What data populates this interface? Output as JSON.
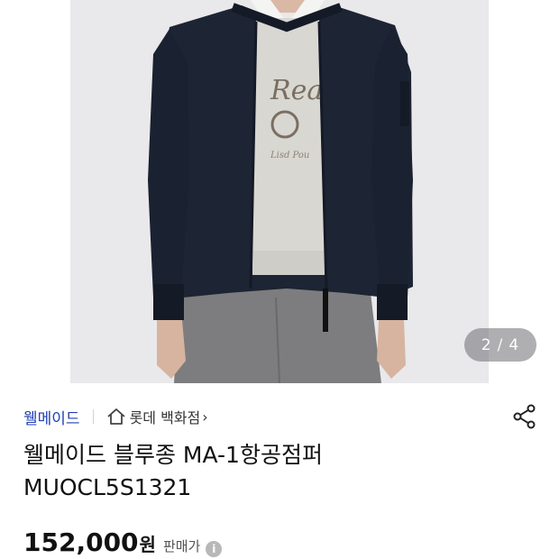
{
  "gallery": {
    "current_page": "2",
    "total_pages": "4",
    "separator": "/",
    "image_description_icon": "product-photo-jacket"
  },
  "product": {
    "brand": "웰메이드",
    "store": "롯데 백화점",
    "store_chevron": "›",
    "title_line1": "웰메이드 블루종 MA-1항공점퍼",
    "title_line2": "MUOCL5S1321",
    "price": "152,000",
    "currency": "원",
    "price_type": "판매가",
    "info_icon_glyph": "i"
  },
  "colors": {
    "brand": "#1f3fb5",
    "jacket": "#1d2433",
    "pager_bg": "#6e6e73"
  }
}
